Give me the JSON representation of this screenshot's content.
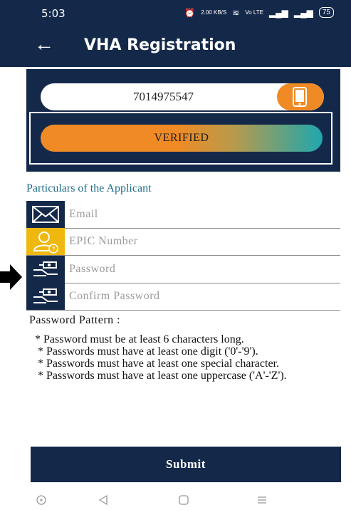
{
  "status_bar": {
    "time": "5:03",
    "speed": "2.00 KB/S",
    "network": "Vo LTE",
    "battery": "75"
  },
  "app_bar": {
    "title": "VHA Registration"
  },
  "phone": {
    "value": "7014975547"
  },
  "verified_label": "VERIFIED",
  "section_title": "Particulars of the Applicant",
  "form": {
    "email_placeholder": "Email",
    "epic_placeholder": "EPIC Number",
    "password_placeholder": "Password",
    "confirm_password_placeholder": "Confirm Password"
  },
  "pattern": {
    "title": "Password Pattern :",
    "rules": [
      "* Password must be at least 6 characters long.",
      "* Passwords must have at least one digit ('0'-'9').",
      "* Passwords must have at least one special character.",
      "* Passwords must have at least one uppercase ('A'-'Z')."
    ]
  },
  "submit_label": "Submit",
  "colors": {
    "primary": "#14294a",
    "accent_orange": "#f08a24",
    "accent_yellow": "#efb80e",
    "accent_teal": "#1fa7ae",
    "section_title": "#1f6e8c"
  }
}
